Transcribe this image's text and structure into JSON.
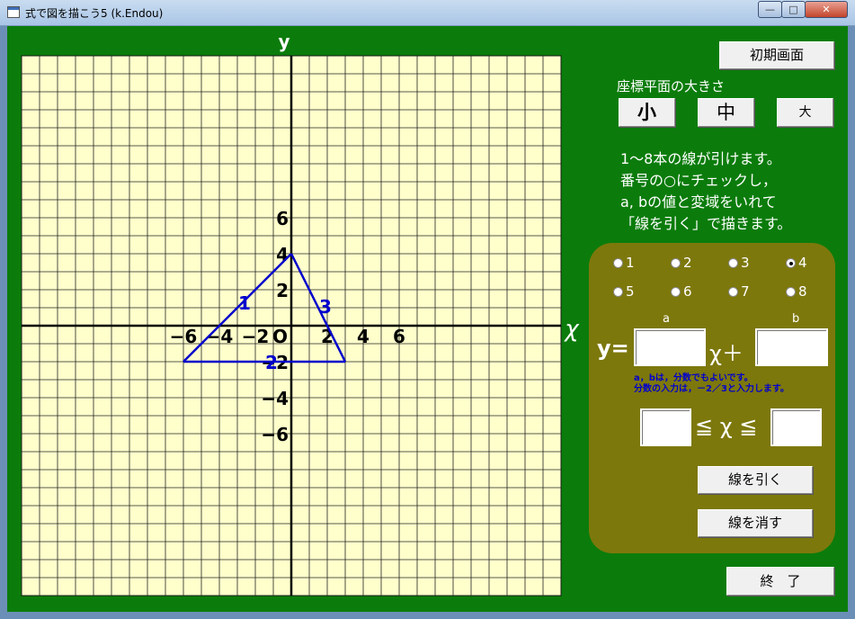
{
  "window": {
    "title": "式で図を描こう5 (k.Endou)",
    "min_glyph": "—",
    "max_glyph": "□",
    "close_glyph": "✕"
  },
  "buttons": {
    "reset": "初期画面",
    "small": "小",
    "medium": "中",
    "large": "大",
    "draw": "線を引く",
    "erase": "線を消す",
    "quit": "終　了"
  },
  "labels": {
    "size_heading": "座標平面の大きさ",
    "instructions": [
      "1～8本の線が引けます。",
      "番号の○にチェックし，",
      "a, bの値と変域をいれて",
      "「線を引く」で描きます。"
    ],
    "a": "a",
    "b": "b",
    "y_eq": "y=",
    "x_plus": "χ＋",
    "note1": "a，bは，分数でもよいです。",
    "note2": "分数の入力は，－2／3と入力します。",
    "range": "≦ χ ≦"
  },
  "radios": [
    {
      "label": "1",
      "checked": false
    },
    {
      "label": "2",
      "checked": false
    },
    {
      "label": "3",
      "checked": false
    },
    {
      "label": "4",
      "checked": true
    },
    {
      "label": "5",
      "checked": false
    },
    {
      "label": "6",
      "checked": false
    },
    {
      "label": "7",
      "checked": false
    },
    {
      "label": "8",
      "checked": false
    }
  ],
  "inputs": {
    "a": "",
    "b": "",
    "x_min": "",
    "x_max": ""
  },
  "graph": {
    "x_axis_label": "χ",
    "y_axis_label": "y",
    "origin_label": "O",
    "x_tick_labels": [
      "−6",
      "−4",
      "−2",
      "2",
      "4",
      "6"
    ],
    "y_tick_labels": [
      "6",
      "4",
      "2",
      "−2",
      "−4",
      "−6"
    ],
    "lines": [
      {
        "id": "1",
        "from": [
          -6,
          -2
        ],
        "to": [
          0,
          4
        ],
        "label_at": [
          -2.6,
          0.9
        ]
      },
      {
        "id": "2",
        "from": [
          -6,
          -2
        ],
        "to": [
          3,
          -2
        ],
        "label_at": [
          -1.1,
          -2.4
        ]
      },
      {
        "id": "3",
        "from": [
          0,
          4
        ],
        "to": [
          3,
          -2
        ],
        "label_at": [
          1.9,
          0.7
        ]
      }
    ],
    "line_color": "#0000cc"
  },
  "colors": {
    "background": "#0b7c0b",
    "panel": "#7d780c",
    "grid_bg": "#ffffcc"
  }
}
